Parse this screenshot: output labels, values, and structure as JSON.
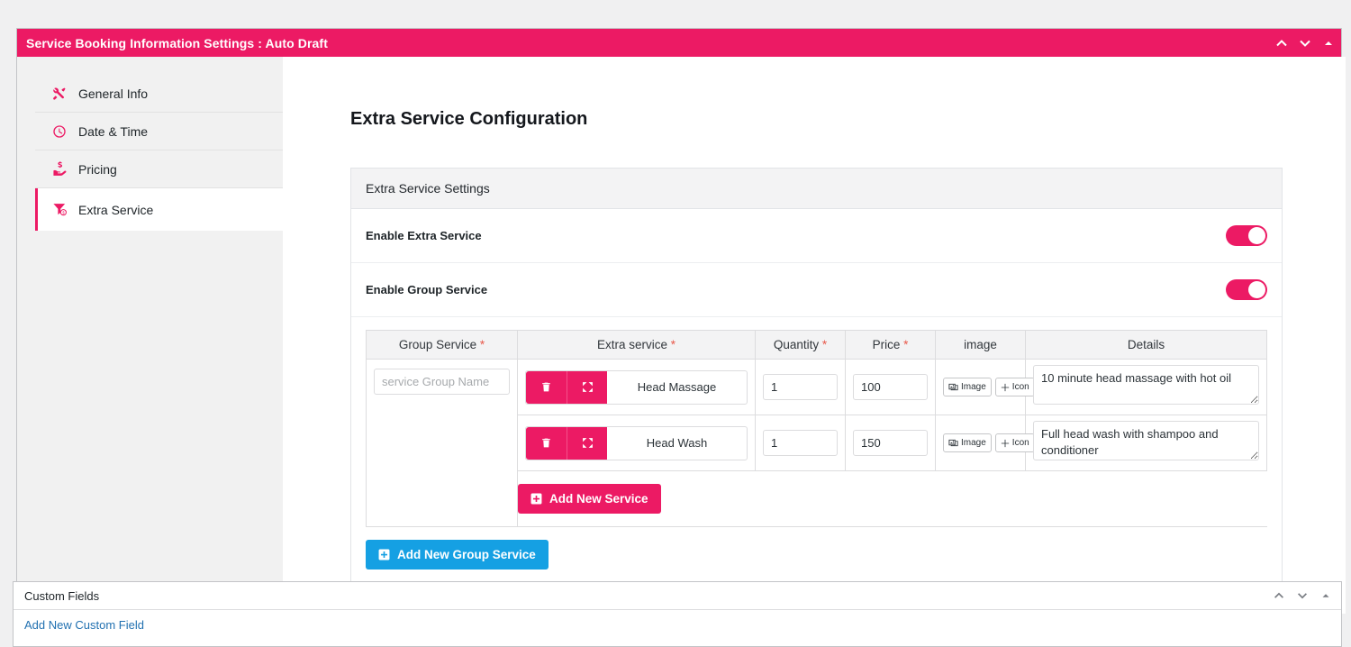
{
  "panel": {
    "title": "Service Booking Information Settings : Auto Draft",
    "controls": [
      {
        "name": "move-up-icon",
        "glyph": "chevron-up"
      },
      {
        "name": "move-down-icon",
        "glyph": "chevron-down"
      },
      {
        "name": "toggle-panel-icon",
        "glyph": "triangle-up"
      }
    ],
    "accent_color": "#ec1a64"
  },
  "sidebar": {
    "items": [
      {
        "label": "General Info",
        "icon": "tools-icon",
        "active": false
      },
      {
        "label": "Date & Time",
        "icon": "clock-icon",
        "active": false
      },
      {
        "label": "Pricing",
        "icon": "hand-holding-dollar-icon",
        "active": false
      },
      {
        "label": "Extra Service",
        "icon": "filter-dollar-icon",
        "active": true
      }
    ]
  },
  "main": {
    "page_title": "Extra Service Configuration",
    "card_header": "Extra Service Settings",
    "switches": [
      {
        "label": "Enable Extra Service",
        "on": true
      },
      {
        "label": "Enable Group Service",
        "on": true
      }
    ],
    "table": {
      "headers": [
        {
          "label": "Group Service",
          "required": true
        },
        {
          "label": "Extra service",
          "required": true
        },
        {
          "label": "Quantity",
          "required": true
        },
        {
          "label": "Price",
          "required": true
        },
        {
          "label": "image",
          "required": false
        },
        {
          "label": "Details",
          "required": false
        }
      ],
      "group_name_placeholder": "service Group Name",
      "group_name_value": "",
      "rows": [
        {
          "service_name": "Head Massage",
          "quantity": "1",
          "price": "100",
          "details": "10 minute head massage with hot oil",
          "image_button": "Image",
          "icon_button": "Icon",
          "delete_icon": "trash-icon",
          "move_icon": "move-arrows-icon"
        },
        {
          "service_name": "Head Wash",
          "quantity": "1",
          "price": "150",
          "details": "Full head wash with shampoo and conditioner",
          "image_button": "Image",
          "icon_button": "Icon",
          "delete_icon": "trash-icon",
          "move_icon": "move-arrows-icon"
        }
      ]
    },
    "add_new_service_label": "Add New Service",
    "add_new_group_service_label": "Add New Group Service",
    "add_service_color": "#ec1a64",
    "add_group_color": "#15a0e3"
  },
  "custom_fields_panel": {
    "title": "Custom Fields",
    "add_link": "Add New Custom Field",
    "controls": [
      {
        "name": "move-up-icon",
        "glyph": "chevron-up"
      },
      {
        "name": "move-down-icon",
        "glyph": "chevron-down"
      },
      {
        "name": "toggle-panel-icon",
        "glyph": "triangle-up"
      }
    ]
  }
}
